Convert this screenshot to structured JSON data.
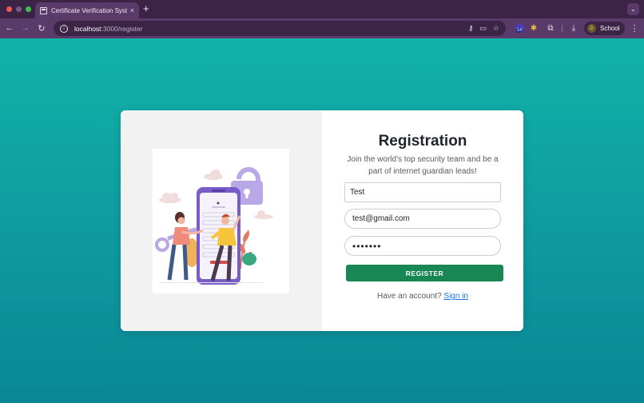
{
  "browser": {
    "tab_title": "Certificate Verification Syste",
    "tab_close": "×",
    "new_tab": "+",
    "tab_menu": "⌄",
    "url_host": "localhost",
    "url_path": ":3000/register",
    "extension_badge": "14",
    "profile_initial": "D",
    "profile_label": "School",
    "icons": {
      "back": "←",
      "forward": "→",
      "reload": "↻",
      "info": "i",
      "password_key": "⚷",
      "cast": "▭",
      "star": "☆",
      "puzzle": "⧉",
      "download": "⤓",
      "menu": "⋮"
    }
  },
  "page": {
    "title": "Registration",
    "subtitle": "Join the world's top security team and be a part of internet guardian leads!",
    "form": {
      "name_value": "Test",
      "email_value": "test@gmail.com",
      "password_value": "•••••••",
      "register_label": "REGISTER"
    },
    "signin_prompt": "Have an account? ",
    "signin_link": "Sign in"
  },
  "colors": {
    "background_top": "#12b2a8",
    "background_bottom": "#0a8795",
    "chrome": "#5a3a68",
    "button": "#198754",
    "link": "#1a73e8"
  }
}
